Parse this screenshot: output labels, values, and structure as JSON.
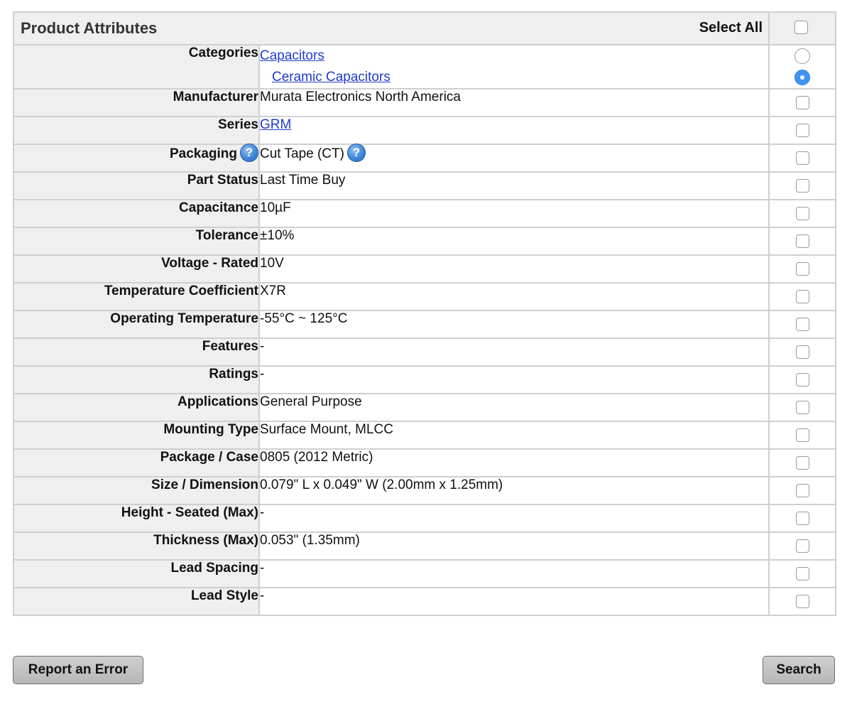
{
  "header": {
    "title": "Product Attributes",
    "select_all_label": "Select All"
  },
  "categories": {
    "label": "Categories",
    "items": [
      "Capacitors",
      "Ceramic Capacitors"
    ],
    "selected_index": 1
  },
  "rows": [
    {
      "label": "Manufacturer",
      "value": "Murata Electronics North America"
    },
    {
      "label": "Series",
      "value": "GRM",
      "link": true
    },
    {
      "label": "Packaging",
      "value": "Cut Tape (CT)",
      "help": true
    },
    {
      "label": "Part Status",
      "value": "Last Time Buy"
    },
    {
      "label": "Capacitance",
      "value": "10µF"
    },
    {
      "label": "Tolerance",
      "value": "±10%"
    },
    {
      "label": "Voltage - Rated",
      "value": "10V"
    },
    {
      "label": "Temperature Coefficient",
      "value": "X7R"
    },
    {
      "label": "Operating Temperature",
      "value": "-55°C ~ 125°C"
    },
    {
      "label": "Features",
      "value": "-"
    },
    {
      "label": "Ratings",
      "value": "-"
    },
    {
      "label": "Applications",
      "value": "General Purpose"
    },
    {
      "label": "Mounting Type",
      "value": "Surface Mount, MLCC"
    },
    {
      "label": "Package / Case",
      "value": "0805 (2012 Metric)"
    },
    {
      "label": "Size / Dimension",
      "value": "0.079\" L x 0.049\" W (2.00mm x 1.25mm)"
    },
    {
      "label": "Height - Seated (Max)",
      "value": "-"
    },
    {
      "label": "Thickness (Max)",
      "value": "0.053\" (1.35mm)"
    },
    {
      "label": "Lead Spacing",
      "value": "-"
    },
    {
      "label": "Lead Style",
      "value": "-"
    }
  ],
  "buttons": {
    "report_label": "Report an Error",
    "search_label": "Search"
  },
  "icons": {
    "help": "question-help-icon"
  },
  "help_glyph": "?",
  "colors": {
    "link": "#1f3cc9",
    "radio_selected": "#3d95f0",
    "label_bg": "#efefef",
    "border": "#cfcfcf"
  }
}
